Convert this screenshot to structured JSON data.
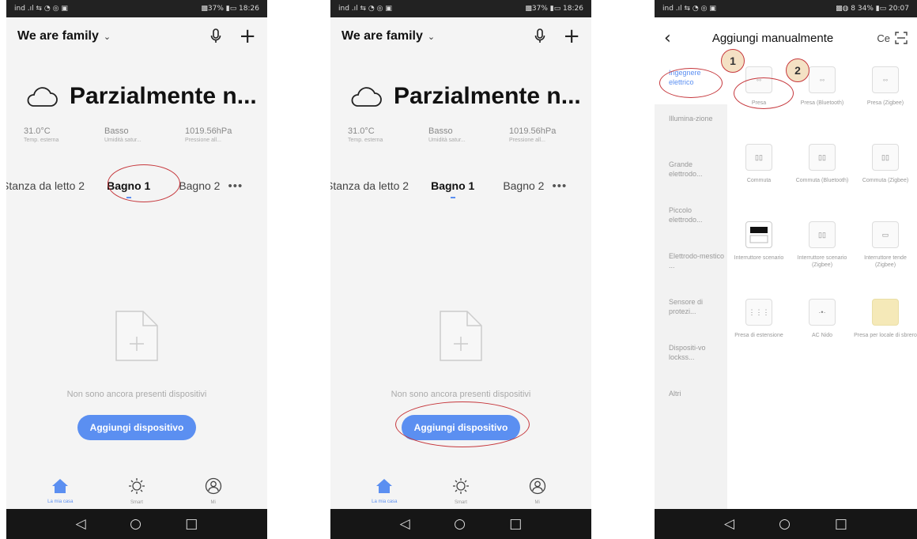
{
  "app": {
    "home_name": "We are family",
    "weather": {
      "condition": "Parzialmente n...",
      "stats": [
        {
          "value": "31.0°C",
          "label": "Temp. esterna"
        },
        {
          "value": "Basso",
          "label": "Umidità satur..."
        },
        {
          "value": "1019.56hPa",
          "label": "Pressione all..."
        }
      ]
    },
    "rooms": [
      "Stanza da letto 2",
      "Bagno 1",
      "Bagno 2"
    ],
    "active_room": "Bagno 1",
    "empty_text": "Non sono ancora presenti dispositivi",
    "add_button": "Aggiungi dispositivo",
    "tabs": [
      "La mia casa",
      "Smart",
      "Mi"
    ],
    "accent_color": "#5b8ff1",
    "annotation_color": "#c6373c"
  },
  "status": {
    "left": "ind .ıl ⇆ ◔ ◎ ▣",
    "right_1": "▩37% ▮▭ 18:26",
    "right_3": "▩◍ 8 34% ▮▭ 20:07"
  },
  "add_manual": {
    "title": "Aggiungi manualmente",
    "right_label": "Ce",
    "categories": [
      "Ingegnere elettrico",
      "Illumina-zione",
      "Grande elettrodo...",
      "Piccolo elettrodo...",
      "Elettrodo-mestico ...",
      "Sensore di protezi...",
      "Dispositi-vo lockss...",
      "Altri"
    ],
    "devices": [
      "Presa",
      "Presa (Bluetooth)",
      "Presa (Zigbee)",
      "Commuta",
      "Commuta (Bluetooth)",
      "Commuta (Zigbee)",
      "Interruttore scenario",
      "Interruttore scenario (Zigbee)",
      "Interruttore tende (Zigbee)",
      "Presa di estensione",
      "AC Nido",
      "Presa per locale di sbrero"
    ],
    "markers": [
      "1",
      "2"
    ]
  }
}
